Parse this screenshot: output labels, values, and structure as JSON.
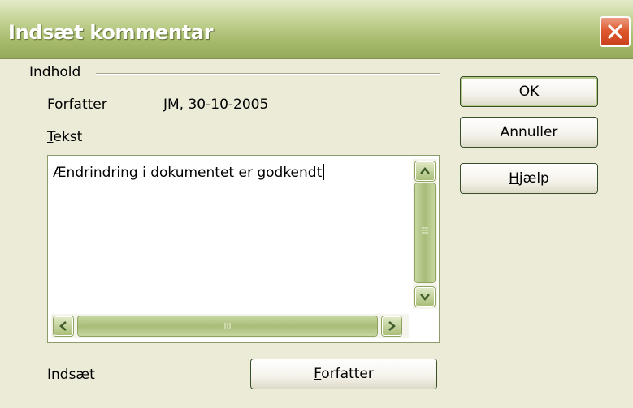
{
  "titlebar": {
    "title": "Indsæt kommentar",
    "close_icon": "close-icon"
  },
  "group": {
    "label": "Indhold"
  },
  "author": {
    "label": "Forfatter",
    "value": "JM, 30-10-2005"
  },
  "text_field": {
    "label": "Tekst",
    "value": "Ændrindring i dokumentet er godkendt"
  },
  "insert": {
    "label": "Indsæt",
    "author_button": "Forfatter"
  },
  "buttons": {
    "ok": "OK",
    "cancel": "Annuller",
    "help": "Hjælp"
  },
  "colors": {
    "titlebar": "#a7bb6c",
    "dialog_background": "#ecebd8",
    "close_button": "#df5a30"
  }
}
